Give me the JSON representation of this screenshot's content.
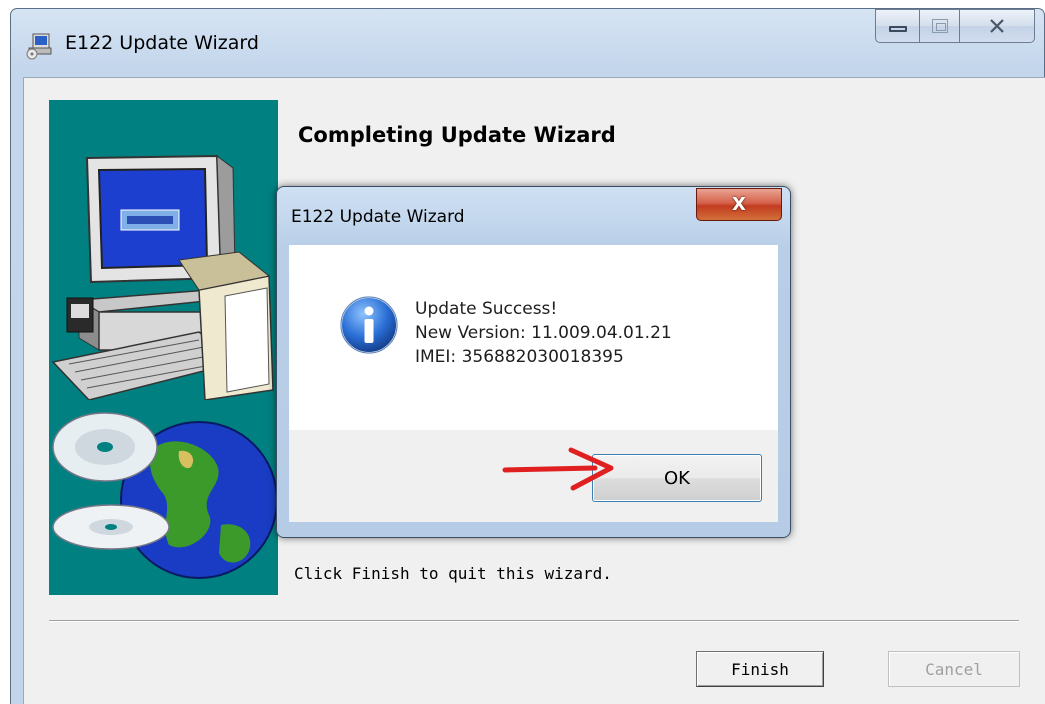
{
  "main_window": {
    "title": "E122 Update Wizard",
    "heading": "Completing Update Wizard",
    "instruction": "Click Finish to quit this wizard.",
    "buttons": {
      "finish": "Finish",
      "cancel": "Cancel"
    }
  },
  "dialog": {
    "title": "E122 Update Wizard",
    "close_glyph": "X",
    "messages": [
      "Update Success!",
      "New Version: 11.009.04.01.21",
      "IMEI: 356882030018395"
    ],
    "ok_label": "OK"
  },
  "colors": {
    "wizard_panel": "#008080",
    "annotation_arrow": "#e02020",
    "close_button": "#c23c20"
  },
  "icons": [
    "setup-icon",
    "minimize-icon",
    "maximize-icon",
    "close-icon",
    "info-icon",
    "computer-illustration",
    "globe-cd-illustration",
    "red-arrow-annotation"
  ]
}
